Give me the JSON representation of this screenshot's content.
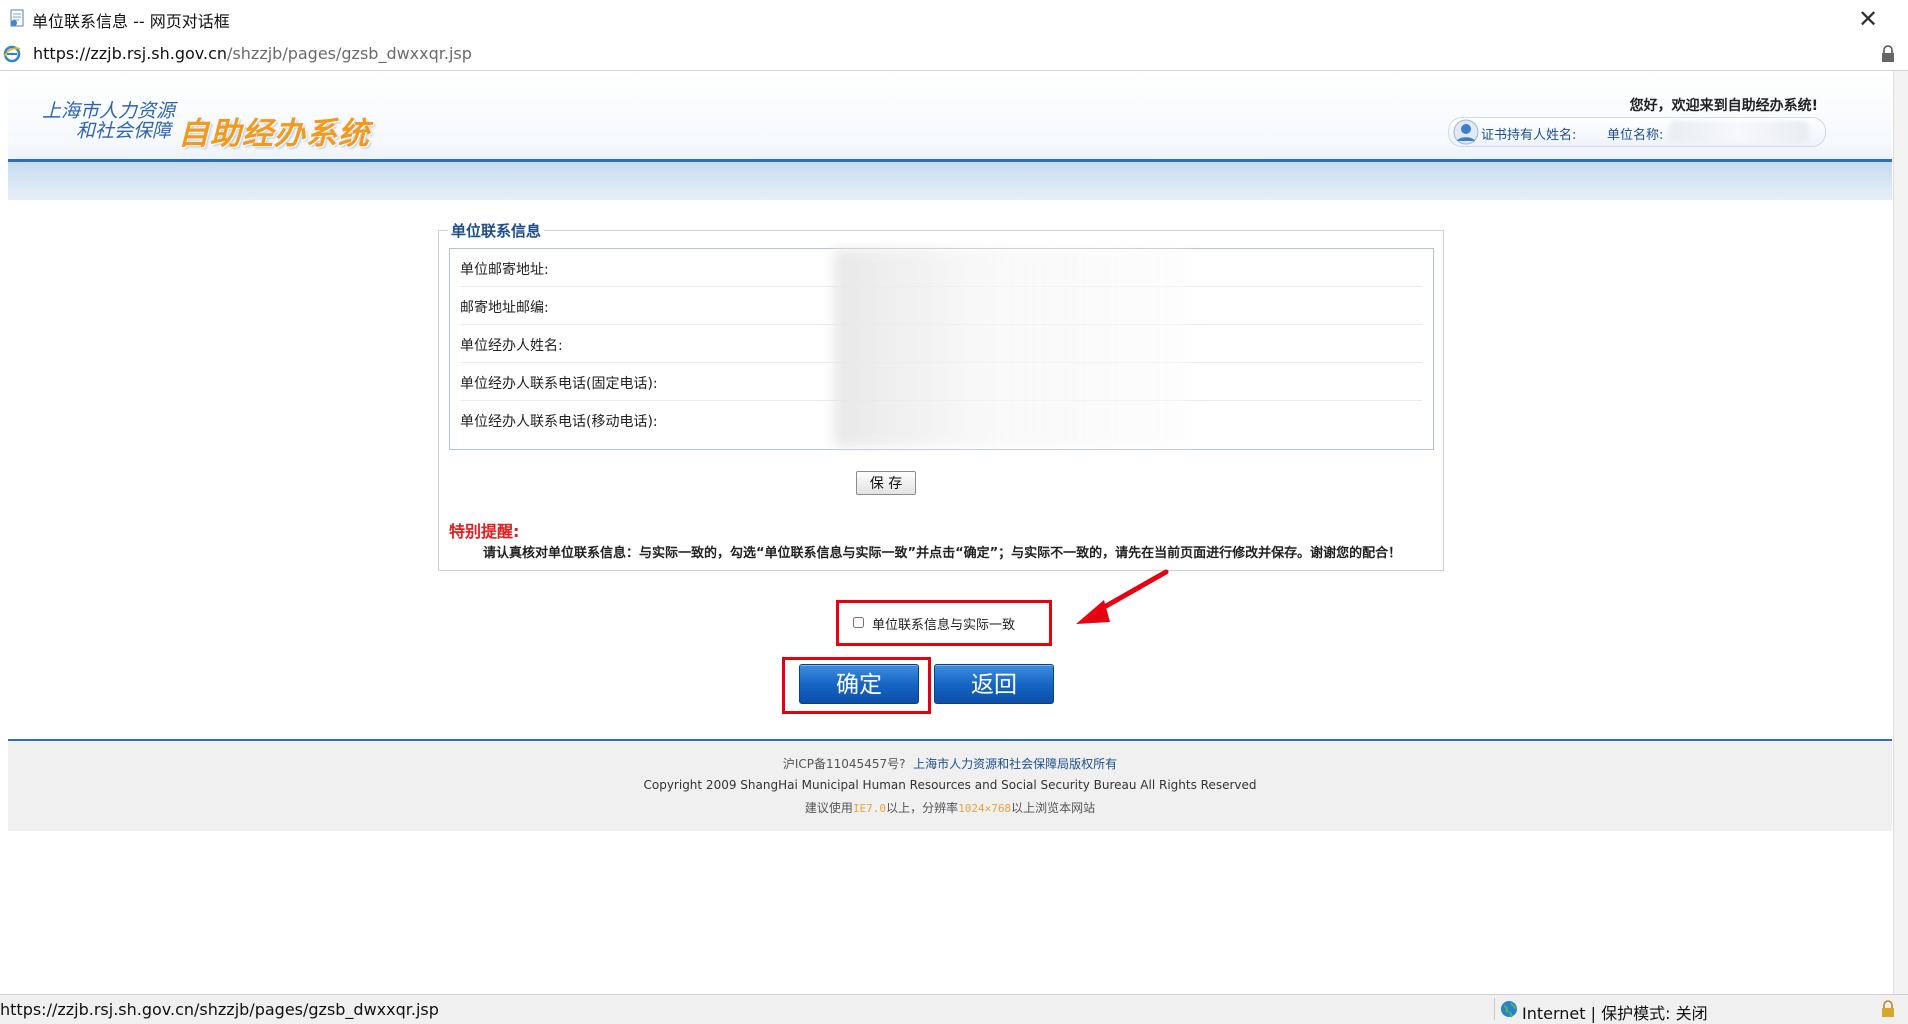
{
  "window": {
    "title": "单位联系信息 -- 网页对话框",
    "close_glyph": "✕"
  },
  "address": {
    "url_host": "https://zzjb.rsj.sh.gov.cn",
    "url_path": "/shzzjb/pages/gzsb_dwxxqr.jsp"
  },
  "header": {
    "logo_line1": "上海市人力资源",
    "logo_line2": "和社会保障",
    "system_name": "自助经办系统",
    "welcome": "您好，欢迎来到自助经办系统!",
    "cert_holder_label": "证书持有人姓名:",
    "unit_name_label": "单位名称:"
  },
  "form": {
    "legend": "单位联系信息",
    "rows": [
      {
        "label": "单位邮寄地址:"
      },
      {
        "label": "邮寄地址邮编:"
      },
      {
        "label": "单位经办人姓名:"
      },
      {
        "label": "单位经办人联系电话(固定电话):"
      },
      {
        "label": "单位经办人联系电话(移动电话):"
      }
    ],
    "save_label": "保 存",
    "notice_title": "特别提醒:",
    "notice_text": "请认真核对单位联系信息：与实际一致的，勾选“单位联系信息与实际一致”并点击“确定”；与实际不一致的，请先在当前页面进行修改并保存。谢谢您的配合！"
  },
  "confirm": {
    "checkbox_label": "单位联系信息与实际一致",
    "checked": false,
    "ok_label": "确定",
    "back_label": "返回",
    "highlight_color": "#e60012"
  },
  "footer": {
    "icp": "沪ICP备11045457号?",
    "owner_link": "上海市人力资源和社会保障局版权所有",
    "copyright": "Copyright 2009 ShangHai Municipal Human Resources and Social Security Bureau All Rights Reserved",
    "suggest_prefix": "建议使用",
    "suggest_browser": "IE7.0",
    "suggest_mid": "以上，分辨率",
    "suggest_resolution": "1024×768",
    "suggest_suffix": "以上浏览本网站"
  },
  "statusbar": {
    "url": "https://zzjb.rsj.sh.gov.cn/shzzjb/pages/gzsb_dwxxqr.jsp",
    "zone": "Internet | 保护模式: 关闭"
  },
  "colors": {
    "brand_blue": "#2f6fb4",
    "button_blue": "#1666c6",
    "logo_orange": "#f29a1f",
    "alert_red": "#e02020"
  }
}
